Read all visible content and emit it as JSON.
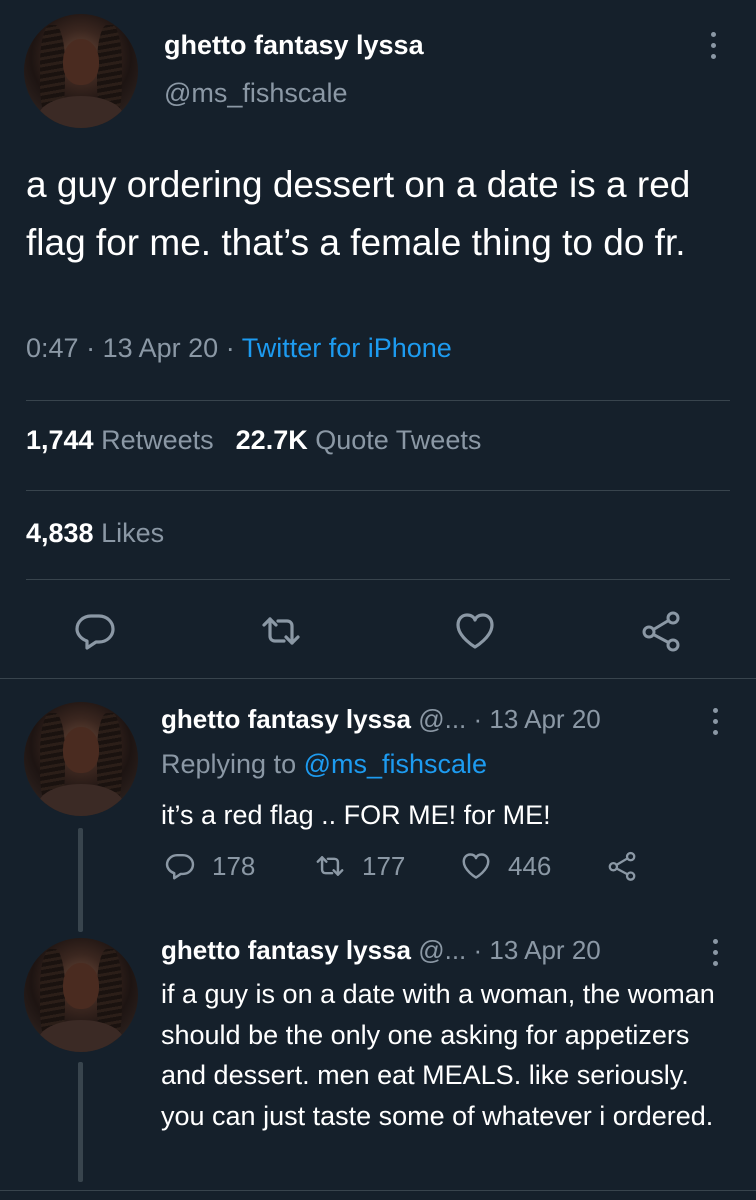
{
  "main_tweet": {
    "display_name": "ghetto fantasy lyssa",
    "handle": "@ms_fishscale",
    "text": "a guy ordering dessert on a date is a red flag for me. that’s a female thing to do fr.",
    "time": "0:47",
    "date": "13 Apr 20",
    "source": "Twitter for iPhone",
    "retweets_count": "1,744",
    "retweets_label": "Retweets",
    "quotes_count": "22.7K",
    "quotes_label": "Quote Tweets",
    "likes_count": "4,838",
    "likes_label": "Likes",
    "actions": [
      "reply-icon",
      "retweet-icon",
      "like-icon",
      "share-icon"
    ]
  },
  "replies": [
    {
      "display_name": "ghetto fantasy lyssa",
      "handle_truncated": "@...",
      "date": "13 Apr 20",
      "replying_prefix": "Replying to",
      "replying_mention": "@ms_fishscale",
      "text": "it’s a red flag .. FOR ME! for ME!",
      "reply_count": "178",
      "retweet_count": "177",
      "like_count": "446"
    },
    {
      "display_name": "ghetto fantasy lyssa",
      "handle_truncated": "@...",
      "date": "13 Apr 20",
      "text": "if a guy is on a date with a woman, the woman should be the only one asking for appetizers and dessert. men eat MEALS. like seriously. you can just taste some of whatever i ordered."
    }
  ],
  "colors": {
    "background": "#15202b",
    "text_primary": "#ffffff",
    "text_secondary": "#8b98a5",
    "accent": "#1d9bf0",
    "divider": "#38444d"
  }
}
